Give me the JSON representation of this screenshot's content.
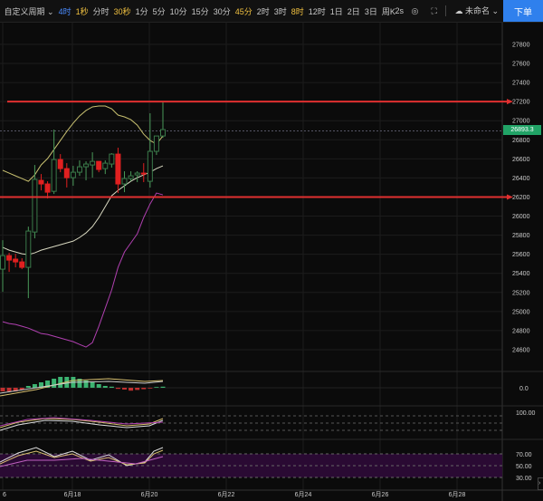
{
  "toolbar": {
    "custom_period": "自定义周期",
    "intervals": [
      {
        "label": "4时",
        "state": "active"
      },
      {
        "label": "1秒",
        "state": "fav"
      },
      {
        "label": "分时",
        "state": ""
      },
      {
        "label": "30秒",
        "state": "fav"
      },
      {
        "label": "1分",
        "state": ""
      },
      {
        "label": "5分",
        "state": ""
      },
      {
        "label": "10分",
        "state": ""
      },
      {
        "label": "15分",
        "state": ""
      },
      {
        "label": "30分",
        "state": ""
      },
      {
        "label": "45分",
        "state": "fav"
      },
      {
        "label": "2时",
        "state": ""
      },
      {
        "label": "3时",
        "state": ""
      },
      {
        "label": "8时",
        "state": "fav"
      },
      {
        "label": "12时",
        "state": ""
      },
      {
        "label": "1日",
        "state": ""
      },
      {
        "label": "2日",
        "state": ""
      },
      {
        "label": "3日",
        "state": ""
      },
      {
        "label": "周K",
        "state": ""
      }
    ],
    "refresh": "2s",
    "layout_name": "未命名",
    "order_button": "下单"
  },
  "current_price": "26893.3",
  "colors": {
    "up": "#2e8b57",
    "down": "#e02020",
    "accent": "#2f80ed"
  },
  "chart_data": {
    "type": "candlestick",
    "price_axis": [
      27800,
      27600,
      27400,
      27200,
      27000,
      26800,
      26600,
      26400,
      26200,
      26000,
      25800,
      25600,
      25400,
      25200,
      25000,
      24800,
      24600
    ],
    "x_labels": [
      "6",
      "6月18",
      "6月20",
      "6月22",
      "6月24",
      "6月26",
      "6月28"
    ],
    "horizontal_lines": [
      27200,
      26200
    ],
    "candles": [
      [
        25444,
        25748,
        25206,
        25586
      ],
      [
        25586,
        25615,
        25415,
        25539
      ],
      [
        25549,
        25605,
        25463,
        25520
      ],
      [
        25520,
        25558,
        25444,
        25463
      ],
      [
        25463,
        25890,
        25140,
        25843
      ],
      [
        25833,
        26536,
        25767,
        26385
      ],
      [
        26375,
        26441,
        26270,
        26337
      ],
      [
        26337,
        26365,
        26185,
        26251
      ],
      [
        26260,
        26907,
        26232,
        26593
      ],
      [
        26593,
        26650,
        26460,
        26498
      ],
      [
        26498,
        26555,
        26300,
        26403
      ],
      [
        26403,
        26527,
        26318,
        26460
      ],
      [
        26460,
        26584,
        26422,
        26517
      ],
      [
        26517,
        26574,
        26375,
        26546
      ],
      [
        26536,
        26669,
        26403,
        26574
      ],
      [
        26574,
        26574,
        26460,
        26489
      ],
      [
        26498,
        26584,
        26441,
        26555
      ],
      [
        26546,
        26660,
        26508,
        26650
      ],
      [
        26650,
        26717,
        26242,
        26337
      ],
      [
        26337,
        26470,
        26251,
        26394
      ],
      [
        26394,
        26470,
        26365,
        26422
      ],
      [
        26432,
        26470,
        26356,
        26451
      ],
      [
        26451,
        26555,
        26356,
        26441
      ],
      [
        26365,
        27078,
        26299,
        26679
      ],
      [
        26679,
        26840,
        26641,
        26840
      ],
      [
        26840,
        27192,
        26821,
        26907
      ]
    ],
    "upper_band": [
      26480,
      26451,
      26422,
      26394,
      26365,
      26432,
      26537,
      26603,
      26698,
      26793,
      26888,
      26974,
      27050,
      27107,
      27145,
      27154,
      27154,
      27125,
      27059,
      27040,
      27011,
      26954,
      26859,
      26793,
      26755,
      26840
    ],
    "middle_band": [
      25672,
      25643,
      25624,
      25605,
      25596,
      25615,
      25643,
      25662,
      25681,
      25700,
      25719,
      25738,
      25776,
      25824,
      25890,
      25985,
      26099,
      26213,
      26270,
      26318,
      26365,
      26403,
      26432,
      26460,
      26498,
      26527
    ],
    "ma_pink": [
      24893,
      24874,
      24864,
      24845,
      24826,
      24798,
      24769,
      24760,
      24741,
      24722,
      24703,
      24684,
      24655,
      24627,
      24674,
      24845,
      25035,
      25225,
      25463,
      25624,
      25719,
      25814,
      25985,
      26128,
      26242,
      26223
    ],
    "macd": {
      "zero_label": "0.0",
      "hist": [
        -1,
        -1,
        -1,
        -0.5,
        0.5,
        1,
        1.5,
        2,
        2.5,
        3,
        3,
        3,
        2.5,
        2,
        1.5,
        1,
        0.5,
        0.3,
        -0.3,
        -0.5,
        -0.8,
        -0.6,
        -0.4,
        -0.2,
        0.2,
        0.3
      ]
    },
    "osc1": {
      "label": "100.00"
    },
    "osc2": {
      "labels": [
        "70.00",
        "50.00",
        "30.00"
      ]
    }
  }
}
